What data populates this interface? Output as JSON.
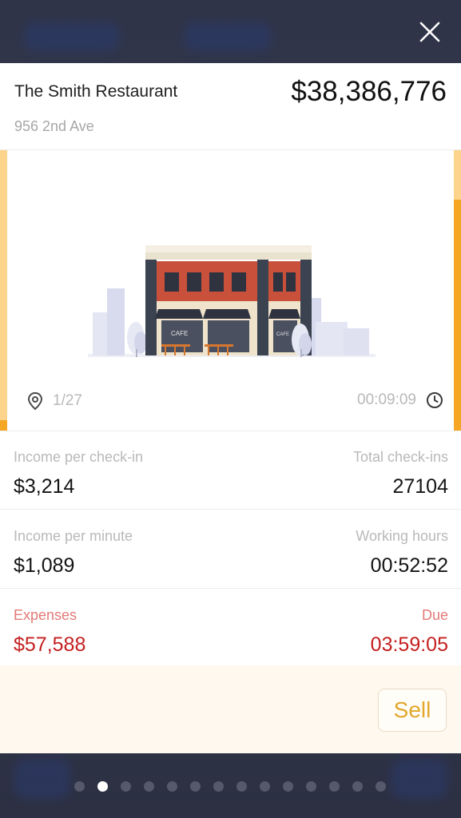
{
  "header": {
    "restaurant_name": "The Smith Restaurant",
    "address": "956 2nd Ave",
    "price": "$38,386,776"
  },
  "image": {
    "location_counter": "1/27",
    "timer": "00:09:09",
    "cafe_sign_1": "CAFE",
    "cafe_sign_2": "CAFE"
  },
  "stats": {
    "income_per_checkin_label": "Income per check-in",
    "income_per_checkin_value": "$3,214",
    "total_checkins_label": "Total check-ins",
    "total_checkins_value": "27104",
    "income_per_minute_label": "Income per minute",
    "income_per_minute_value": "$1,089",
    "working_hours_label": "Working hours",
    "working_hours_value": "00:52:52",
    "expenses_label": "Expenses",
    "expenses_value": "$57,588",
    "due_label": "Due",
    "due_value": "03:59:05"
  },
  "actions": {
    "sell_label": "Sell"
  },
  "pagination": {
    "total_pages": 14,
    "active_index": 1
  },
  "icons": {
    "close": "close-icon",
    "location": "location-pin-icon",
    "clock": "clock-icon"
  },
  "colors": {
    "accent_orange": "#f5a623",
    "accent_light": "#fdd48c",
    "expense_red": "#c41f1f",
    "sell_gold": "#e2a72b",
    "backdrop": "#2d3143"
  }
}
